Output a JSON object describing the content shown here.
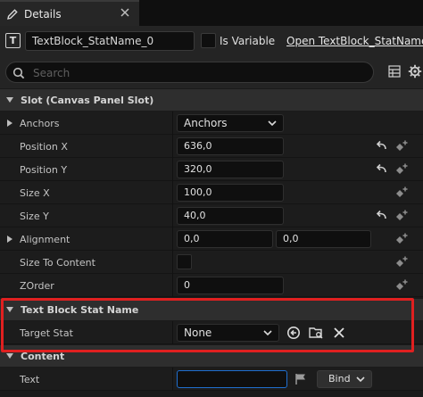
{
  "tab": {
    "label": "Details"
  },
  "header": {
    "type_glyph": "T",
    "name_value": "TextBlock_StatName_0",
    "is_variable_label": "Is Variable",
    "open_link": "Open TextBlock_StatName"
  },
  "search": {
    "placeholder": "Search"
  },
  "sections": {
    "slot": "Slot (Canvas Panel Slot)",
    "textblock": "Text Block Stat Name",
    "content": "Content"
  },
  "slot": {
    "anchors": {
      "label": "Anchors",
      "value": "Anchors"
    },
    "position_x": {
      "label": "Position X",
      "value": "636,0"
    },
    "position_y": {
      "label": "Position Y",
      "value": "320,0"
    },
    "size_x": {
      "label": "Size X",
      "value": "100,0"
    },
    "size_y": {
      "label": "Size Y",
      "value": "40,0"
    },
    "alignment": {
      "label": "Alignment",
      "value_x": "0,0",
      "value_y": "0,0"
    },
    "size_to_content": {
      "label": "Size To Content"
    },
    "zorder": {
      "label": "ZOrder",
      "value": "0"
    }
  },
  "textblock": {
    "target_stat": {
      "label": "Target Stat",
      "value": "None"
    }
  },
  "content": {
    "text": {
      "label": "Text",
      "value": "",
      "bind_label": "Bind"
    }
  },
  "colors": {
    "highlight_border": "#e02020",
    "accent": "#1f6fd0"
  }
}
